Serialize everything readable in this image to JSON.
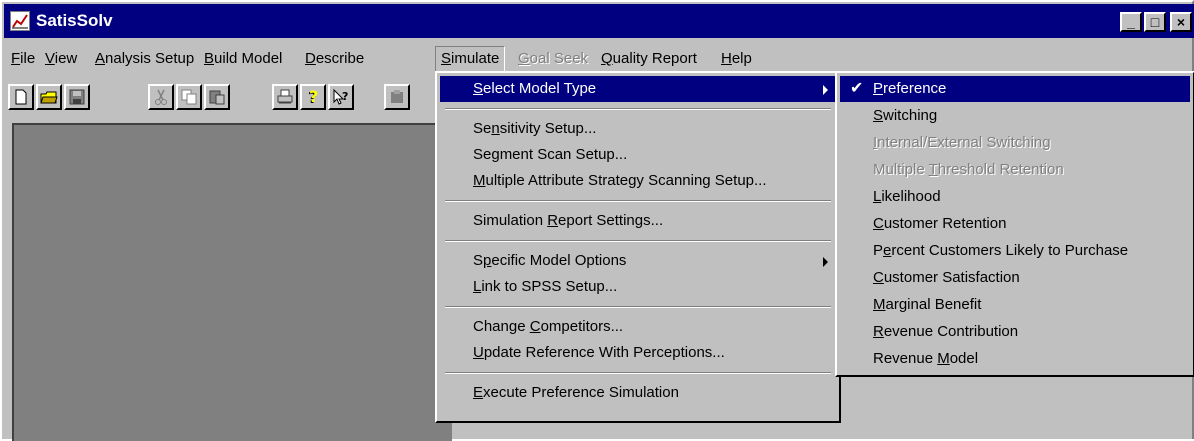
{
  "window": {
    "title": "SatisSolv",
    "min_glyph": "_",
    "max_glyph": "□",
    "close_glyph": "×"
  },
  "menubar": [
    {
      "label": "File",
      "underline": "F",
      "rest": "ile",
      "state": "normal"
    },
    {
      "label": "View",
      "underline": "V",
      "rest": "iew",
      "state": "normal"
    },
    {
      "label": "Analysis Setup",
      "underline": "A",
      "rest": "nalysis Setup",
      "state": "normal"
    },
    {
      "label": "Build Model",
      "underline": "B",
      "rest": "uild Model",
      "state": "normal"
    },
    {
      "label": "Describe",
      "underline": "D",
      "rest": "escribe",
      "state": "normal"
    },
    {
      "label": "Simulate",
      "underline": "S",
      "rest": "imulate",
      "state": "open"
    },
    {
      "label": "Goal Seek",
      "underline": "G",
      "rest": "oal Seek",
      "state": "disabled"
    },
    {
      "label": "Quality Report",
      "underline": "Q",
      "rest": "uality Report",
      "state": "normal"
    },
    {
      "label": "Help",
      "underline": "H",
      "rest": "elp",
      "state": "normal"
    }
  ],
  "toolbar": [
    "new-file-icon",
    "open-folder-icon",
    "save-icon",
    "cut-icon",
    "copy-icon",
    "paste-icon",
    "print-icon",
    "help-icon",
    "context-help-icon",
    "run-icon"
  ],
  "simulate_menu": {
    "items": [
      {
        "pre": "",
        "u": "S",
        "post": "elect Model Type",
        "submenu": true,
        "selected": true
      },
      {
        "separator": true
      },
      {
        "pre": "Se",
        "u": "n",
        "post": "sitivity Setup...",
        "submenu": false
      },
      {
        "pre": "Segment Scan Setup...",
        "u": "",
        "post": "",
        "submenu": false
      },
      {
        "pre": "",
        "u": "M",
        "post": "ultiple Attribute Strategy Scanning Setup...",
        "submenu": false
      },
      {
        "separator": true
      },
      {
        "pre": "Simulation ",
        "u": "R",
        "post": "eport Settings...",
        "submenu": false
      },
      {
        "separator": true
      },
      {
        "pre": "S",
        "u": "p",
        "post": "ecific Model Options",
        "submenu": true
      },
      {
        "pre": "",
        "u": "L",
        "post": "ink to SPSS Setup...",
        "submenu": false
      },
      {
        "separator": true
      },
      {
        "pre": "Change ",
        "u": "C",
        "post": "ompetitors...",
        "submenu": false
      },
      {
        "pre": "",
        "u": "U",
        "post": "pdate Reference With Perceptions...",
        "submenu": false
      },
      {
        "separator": true
      },
      {
        "pre": "",
        "u": "E",
        "post": "xecute Preference Simulation",
        "submenu": false
      }
    ]
  },
  "model_type_menu": {
    "check_glyph": "✔",
    "items": [
      {
        "pre": "",
        "u": "P",
        "post": "reference",
        "checked": true,
        "selected": true,
        "disabled": false
      },
      {
        "pre": "",
        "u": "S",
        "post": "witching",
        "checked": false,
        "selected": false,
        "disabled": false
      },
      {
        "pre": "",
        "u": "I",
        "post": "nternal/External Switching",
        "checked": false,
        "selected": false,
        "disabled": true
      },
      {
        "pre": "Multiple ",
        "u": "T",
        "post": "hreshold Retention",
        "checked": false,
        "selected": false,
        "disabled": true
      },
      {
        "pre": "",
        "u": "L",
        "post": "ikelihood",
        "checked": false,
        "selected": false,
        "disabled": false
      },
      {
        "pre": "",
        "u": "C",
        "post": "ustomer Retention",
        "checked": false,
        "selected": false,
        "disabled": false
      },
      {
        "pre": "P",
        "u": "e",
        "post": "rcent Customers Likely to Purchase",
        "checked": false,
        "selected": false,
        "disabled": false
      },
      {
        "pre": "",
        "u": "C",
        "post": "ustomer Satisfaction",
        "checked": false,
        "selected": false,
        "disabled": false
      },
      {
        "pre": "",
        "u": "M",
        "post": "arginal Benefit",
        "checked": false,
        "selected": false,
        "disabled": false
      },
      {
        "pre": "",
        "u": "R",
        "post": "evenue Contribution",
        "checked": false,
        "selected": false,
        "disabled": false
      },
      {
        "pre": "Revenue ",
        "u": "M",
        "post": "odel",
        "checked": false,
        "selected": false,
        "disabled": false
      }
    ]
  }
}
